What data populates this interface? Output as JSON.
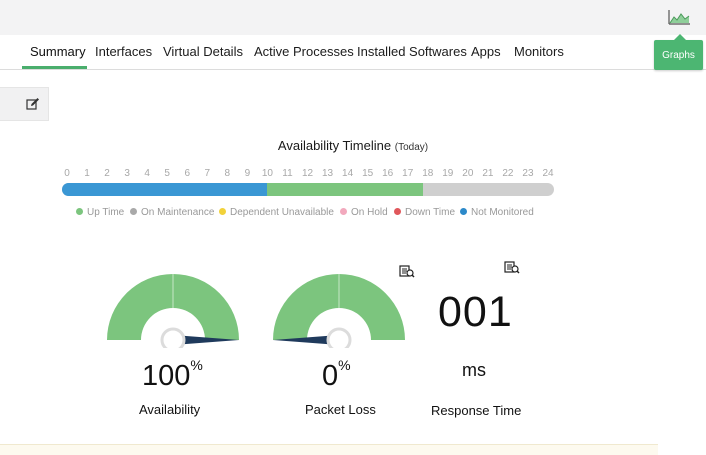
{
  "header": {
    "graphs_label": "Graphs",
    "graphs_icon": "area-chart-icon"
  },
  "tabs": [
    {
      "label": "Summary",
      "active": true
    },
    {
      "label": "Interfaces"
    },
    {
      "label": "Virtual Details"
    },
    {
      "label": "Active Processes"
    },
    {
      "label": "Installed Softwares"
    },
    {
      "label": "Apps"
    },
    {
      "label": "Monitors"
    }
  ],
  "timeline": {
    "title": "Availability Timeline",
    "subtitle": "(Today)",
    "hours": [
      "0",
      "1",
      "2",
      "3",
      "4",
      "5",
      "6",
      "7",
      "8",
      "9",
      "10",
      "11",
      "12",
      "13",
      "14",
      "15",
      "16",
      "17",
      "18",
      "19",
      "20",
      "21",
      "22",
      "23",
      "24"
    ],
    "segments": [
      {
        "status": "Up Time",
        "from_hour": 0,
        "to_hour": 10,
        "color": "#3a97d4"
      },
      {
        "status": "Up Time",
        "from_hour": 10,
        "to_hour": 17.6,
        "color": "#7cc57e"
      }
    ],
    "legend": [
      {
        "label": "Up Time",
        "color": "#7cc57e"
      },
      {
        "label": "On Maintenance",
        "color": "#a9a9a9"
      },
      {
        "label": "Dependent Unavailable",
        "color": "#f2d23a"
      },
      {
        "label": "On Hold",
        "color": "#f2a9bd"
      },
      {
        "label": "Down Time",
        "color": "#e0575b"
      },
      {
        "label": "Not Monitored",
        "color": "#2c89c9"
      }
    ]
  },
  "metrics": {
    "availability": {
      "value": "100",
      "unit": "%",
      "label": "Availability",
      "gauge_fraction": 1.0
    },
    "packet_loss": {
      "value": "0",
      "unit": "%",
      "label": "Packet Loss",
      "gauge_fraction": 0.0
    },
    "response_time": {
      "value": "001",
      "unit": "ms",
      "label": "Response Time"
    }
  },
  "colors": {
    "accent": "#4cb672",
    "gauge_fill": "#7cc57e",
    "needle": "#1f3a5c"
  }
}
